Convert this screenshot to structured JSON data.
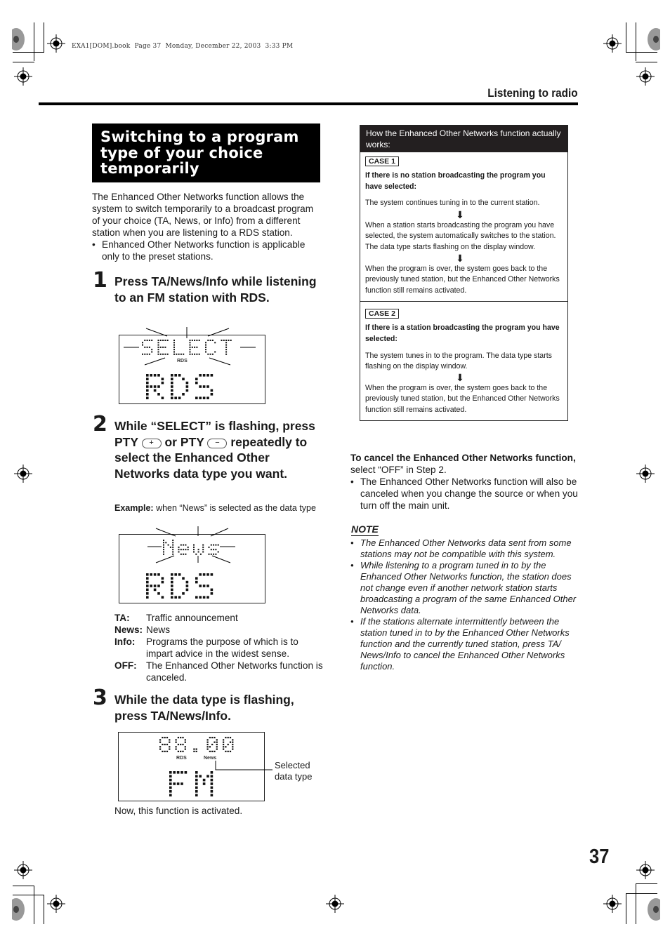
{
  "book_header": "EXA1[DOM].book  Page 37  Monday, December 22, 2003  3:33 PM",
  "running_head": "Listening to radio",
  "page_number": "37",
  "section_title": [
    "Switching to a program",
    "type of your choice",
    "temporarily"
  ],
  "intro": {
    "paragraph": "The Enhanced Other Networks function allows the system to switch temporarily to a broadcast program of your choice (TA, News, or Info) from a different station when you are listening to a RDS station.",
    "bullet": "Enhanced Other Networks function is applicable only to the preset stations."
  },
  "steps": [
    {
      "number": "1",
      "text": "Press TA/News/Info while listening to an FM station with RDS.",
      "display": {
        "top_text": "SELECT",
        "indicator": "RDS",
        "bottom_text": "RDS",
        "flashing": true
      }
    },
    {
      "number": "2",
      "text_part1": "While “SELECT” is flashing, press PTY",
      "button_plus": "+",
      "text_part2": "or PTY",
      "button_minus": "−",
      "text_part3": "repeatedly to select the Enhanced Other Networks data type you want.",
      "example_label": "Example:",
      "example_text": " when “News” is selected as the data type",
      "display": {
        "top_text": "News",
        "bottom_text": "RDS",
        "flashing": true
      },
      "definitions": [
        {
          "term": "TA:",
          "desc": "Traffic announcement"
        },
        {
          "term": "News:",
          "desc": "News"
        },
        {
          "term": "Info:",
          "desc": "Programs the purpose of which is to impart advice in the widest sense."
        },
        {
          "term": "OFF:",
          "desc": "The Enhanced Other Networks function is canceled."
        }
      ]
    },
    {
      "number": "3",
      "text": "While the data type is flashing, press TA/News/Info.",
      "display": {
        "frequency": "88.00",
        "indicator_rds": "RDS",
        "indicator_type": "News",
        "bottom_text": "FM"
      },
      "callout": "Selected data type",
      "caption": "Now, this function is activated."
    }
  ],
  "info_panel": {
    "title": "How the Enhanced Other Networks function actually works:",
    "cases": [
      {
        "badge": "CASE 1",
        "condition": "If there is no station broadcasting the program you have selected:",
        "sequence": [
          "The system continues tuning in to the current station.",
          "When a station starts broadcasting the program you have selected, the system automatically switches to the station. The data type starts flashing on the display window.",
          "When the program is over, the system goes back to the previously tuned station,  but the Enhanced Other Networks function still remains activated."
        ]
      },
      {
        "badge": "CASE 2",
        "condition": "If there is a station broadcasting the program you have selected:",
        "sequence": [
          "The system tunes in to the program. The data type starts flashing on the display window.",
          "When the program is over, the system goes back to the previously tuned station,  but the Enhanced Other Networks function still remains activated."
        ]
      }
    ]
  },
  "cancel": {
    "bold": "To cancel the Enhanced Other Networks function,",
    "text": " select “OFF” in Step 2.",
    "bullet": "The Enhanced Other Networks function will also be canceled when you change the source or when you turn off the main unit."
  },
  "note": {
    "title": "NOTE",
    "items": [
      "The Enhanced Other Networks data sent from some stations may not be compatible with this system.",
      "While listening to a program tuned in to by the Enhanced Other Networks function, the station does not change even if another network station starts broadcasting a program of the same Enhanced Other Networks data.",
      "If the stations alternate intermittently between the station tuned in to by the Enhanced Other Networks function and the currently tuned station, press TA/ News/Info to cancel the Enhanced Other Networks function."
    ]
  }
}
